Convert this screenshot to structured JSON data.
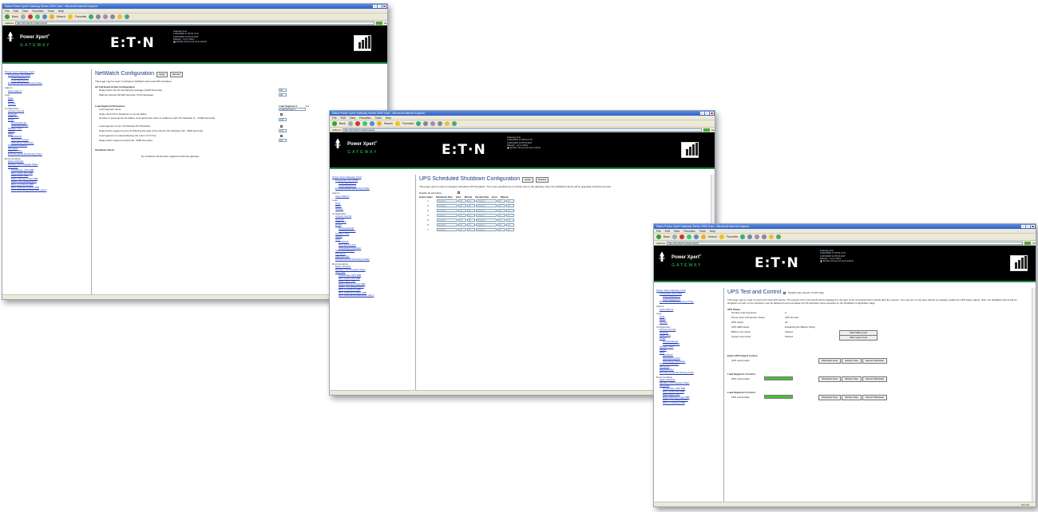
{
  "browser": {
    "title": "Eaton Power Xpert Gateway Series 2000 Card - Microsoft Internet Explorer",
    "menu": [
      "File",
      "Edit",
      "View",
      "Favorites",
      "Tools",
      "Help"
    ],
    "back": "Back",
    "search": "Search",
    "favorites": "Favorites",
    "address_label": "Address",
    "go": "Go",
    "url1": "http://10.222.51.134/content/",
    "url2": "http://10.222.51.134/content/",
    "url3": "http://10.222.51.134/content/"
  },
  "header": {
    "product": "Power Xpert",
    "product_reg": "®",
    "gateway": "GATEWAY",
    "brand": "E:T·N",
    "info1": [
      "Gateway time",
      "11/06/2008 17:56:01 UTC",
      "11/06/2008 12:56:01 EST",
      "Raleigh - Jon's Office",
      "Enable 30 second auto-refresh"
    ],
    "info2": [
      "Gateway time",
      "11/06/2008 17:58:00 UTC",
      "11/06/2008 12:55:00 EST",
      "Raleigh - Jon's Office",
      "Enable 30 second auto-refresh"
    ],
    "info3": [
      "Gateway time",
      "11/06/2008 17:56:54 UTC",
      "11/06/2008 12:56:54 EST",
      "Raleigh - Jon's Office",
      "Enable 30 second auto-refresh"
    ]
  },
  "nav": {
    "top": [
      "Power Xpert Gateway Card",
      "Powerware 9170 RM",
      "Load Segment 1",
      "Load Segment 2",
      "Environmental Monitoring Probe"
    ],
    "alarms_h": "Alarms",
    "alarms": [
      "Open Alarms"
    ],
    "logs_h": "Logs",
    "logs": [
      "Data",
      "Event",
      "System"
    ],
    "config_h": "Configuration",
    "config1": [
      "Access Control",
      "Network",
      "Date/Time",
      "Email"
    ],
    "email": [
      "General Email",
      "Collective Email"
    ],
    "config2": [
      "Modbus TCP",
      "SNMP",
      "UPS"
    ],
    "ups": [
      "NetWatch",
      "Test and Control",
      "Scheduled Shutdown"
    ],
    "config3": [
      "Save and Restore",
      "Firmware",
      "Log Out User",
      "Environmental Monitoring Probe"
    ],
    "doc_h": "Documentation",
    "doc1": [
      "Eaton Website",
      "Modbus TCP Register Maps",
      "MIB Files"
    ],
    "mib": [
      "Powerware UPS MIB",
      "RFC 1628 UPS MIB",
      "Eaton EMP MIB",
      "Eaton Alarms+Traps MIB",
      "Eaton OID assignments",
      "RFC of 12 Entry MIB",
      "RFC 1090 Entry-Bran MIB",
      "RFC 1090 Entry-Bran MIB, part 2"
    ]
  },
  "w1": {
    "title": "NetWatch Configuration",
    "apply": "Apply",
    "discard": "Discard",
    "intro": "This page may be used to configure NetWatch client and UPS shutdown.",
    "sec1": "AC Fail Event Action Configuration",
    "r1": "Delay before the AC fail warning message (0-600 Seconds)",
    "r1v": "60",
    "r2": "Warning Interval (30-600 Seconds, 0=No Message)",
    "r2v": "60",
    "sec2": "Load Segment Parameters",
    "col": "Load Segment 1",
    "col2": "Lo",
    "rows": [
      "Load segment name",
      "Notify client OS to shutdown on an AC failure",
      "Number of seconds the AC failure must last before client is notified to start OS shutdown (1 - 21600 Seconds)",
      "Load segment to turn off following OS Shutdown",
      "Delay before segment turns off following the start of the client's OS shutdown (30 - 3600 Seconds)",
      "Load segment to restart following the return of AC line",
      "Delay before segment restart (10 - 3600 Seconds)"
    ],
    "seg_name": "Load Segment 1",
    "v3": "111",
    "v5": "111",
    "v7": "10",
    "sec3": "Shutdown Client",
    "noclients": "No shutdown clients have registered with this gateway"
  },
  "w2": {
    "title": "UPS Scheduled Shutdown Configuration",
    "apply": "Apply",
    "discard": "Discard",
    "intro": "This page may be used to configure scheduled UPS shutdown. The times specified are in LOCAL time to the gateway. Note, the NetWatch clients will be gracefully shutdown as well.",
    "disable": "Disable all schedules",
    "cols": [
      "Event Index",
      "Shutdown Day",
      "Hour",
      "Minute",
      "Restart Day",
      "Hour",
      "Minute"
    ],
    "idx": [
      "1",
      "2",
      "3",
      "4",
      "5",
      "6",
      "7"
    ],
    "opt_day": "Disabled",
    "opt_num": "00"
  },
  "w3": {
    "title": "UPS Test and Control",
    "autorefresh": "Disable auto-refresh of UPS state",
    "intro": "This page may be used to control the local UPS device. The results of the commands will be displayed to the right of the command button shortly after the request. You may turn on the auto-refresh to regularly update the UPS status values. Note, the NetWatch clients will be shutdown as well, so the shutdown may be delayed to accommodate the OS shutdown times specified on the NetWatch configuration page.",
    "status_h": "UPS Status",
    "status": [
      {
        "k": "Number load segments:",
        "v": "2"
      },
      {
        "k": "Power Xpert architecture status",
        "v": "UPS Normal"
      },
      {
        "k": "UPS status",
        "v": "On"
      },
      {
        "k": "UPS ABM status:",
        "v": "Equalizing the Battery String"
      },
      {
        "k": "Battery test result:",
        "v": "Passed"
      },
      {
        "k": "System test result:",
        "v": "Passed"
      }
    ],
    "start_battery": "Start battery test",
    "start_system": "Start system test",
    "ctrl1_h": "Eaton UPS Output Control",
    "ctrl2_h": "Load Segment 1 Control",
    "ctrl3_h": "Load Segment 2 Control",
    "output_state": "UPS output state",
    "shutdown_now": "Shutdown Now",
    "startup_now": "Startup Now",
    "cancel_shutdown": "Cancel Shutdown",
    "seg1_level": 1.0,
    "seg2_level": 1.0,
    "status_bar": "Internet"
  }
}
